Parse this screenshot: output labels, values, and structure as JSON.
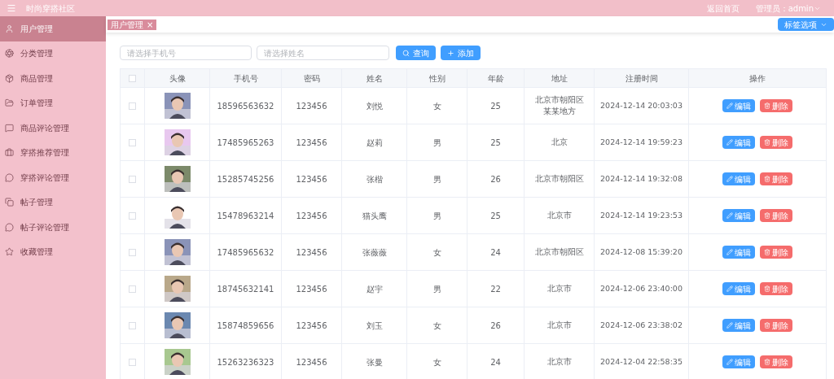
{
  "header": {
    "title": "时尚穿搭社区",
    "home_link": "返回首页",
    "user_label": "管理员：admin"
  },
  "sidebar": {
    "items": [
      {
        "label": "用户管理",
        "selected": true
      },
      {
        "label": "分类管理",
        "selected": false
      },
      {
        "label": "商品管理",
        "selected": false
      },
      {
        "label": "订单管理",
        "selected": false
      },
      {
        "label": "商品评论管理",
        "selected": false
      },
      {
        "label": "穿搭推荐管理",
        "selected": false
      },
      {
        "label": "穿搭评论管理",
        "selected": false
      },
      {
        "label": "帖子管理",
        "selected": false
      },
      {
        "label": "帖子评论管理",
        "selected": false
      },
      {
        "label": "收藏管理",
        "selected": false
      }
    ]
  },
  "tabs": [
    {
      "label": "用户管理",
      "close": "×",
      "selected": true
    }
  ],
  "tab_options": "标签选项",
  "search": {
    "phone_placeholder": "请选择手机号",
    "name_placeholder": "请选择姓名",
    "query_button": "查询",
    "add_button": "添加"
  },
  "table": {
    "select_all_checked": false,
    "columns": [
      "头像",
      "手机号",
      "密码",
      "姓名",
      "性别",
      "年龄",
      "地址",
      "注册时间",
      "操作"
    ],
    "rows": [
      {
        "checked": false,
        "phone": "18596563632",
        "password": "123456",
        "name": "刘悦",
        "gender": "女",
        "age": "25",
        "address": "北京市朝阳区某某地方",
        "registered": "2024-12-14 20:03:03",
        "edit": "编辑",
        "delete": "删除"
      },
      {
        "checked": false,
        "phone": "17485965263",
        "password": "123456",
        "name": "赵莉",
        "gender": "男",
        "age": "25",
        "address": "北京",
        "registered": "2024-12-14 19:59:23",
        "edit": "编辑",
        "delete": "删除"
      },
      {
        "checked": false,
        "phone": "15285745256",
        "password": "123456",
        "name": "张楷",
        "gender": "男",
        "age": "26",
        "address": "北京市朝阳区",
        "registered": "2024-12-14 19:32:08",
        "edit": "编辑",
        "delete": "删除"
      },
      {
        "checked": false,
        "phone": "15478963214",
        "password": "123456",
        "name": "猫头鹰",
        "gender": "男",
        "age": "25",
        "address": "北京市",
        "registered": "2024-12-14 19:23:53",
        "edit": "编辑",
        "delete": "删除"
      },
      {
        "checked": false,
        "phone": "17485965632",
        "password": "123456",
        "name": "张薇薇",
        "gender": "女",
        "age": "24",
        "address": "北京市朝阳区",
        "registered": "2024-12-08 15:39:20",
        "edit": "编辑",
        "delete": "删除"
      },
      {
        "checked": false,
        "phone": "18745632141",
        "password": "123456",
        "name": "赵宇",
        "gender": "男",
        "age": "22",
        "address": "北京市",
        "registered": "2024-12-06 23:40:00",
        "edit": "编辑",
        "delete": "删除"
      },
      {
        "checked": false,
        "phone": "15874859656",
        "password": "123456",
        "name": "刘玉",
        "gender": "女",
        "age": "26",
        "address": "北京市",
        "registered": "2024-12-06 23:38:02",
        "edit": "编辑",
        "delete": "删除"
      },
      {
        "checked": false,
        "phone": "15263236323",
        "password": "123456",
        "name": "张曼",
        "gender": "女",
        "age": "24",
        "address": "北京市",
        "registered": "2024-12-04 22:58:35",
        "edit": "编辑",
        "delete": "删除"
      }
    ]
  }
}
